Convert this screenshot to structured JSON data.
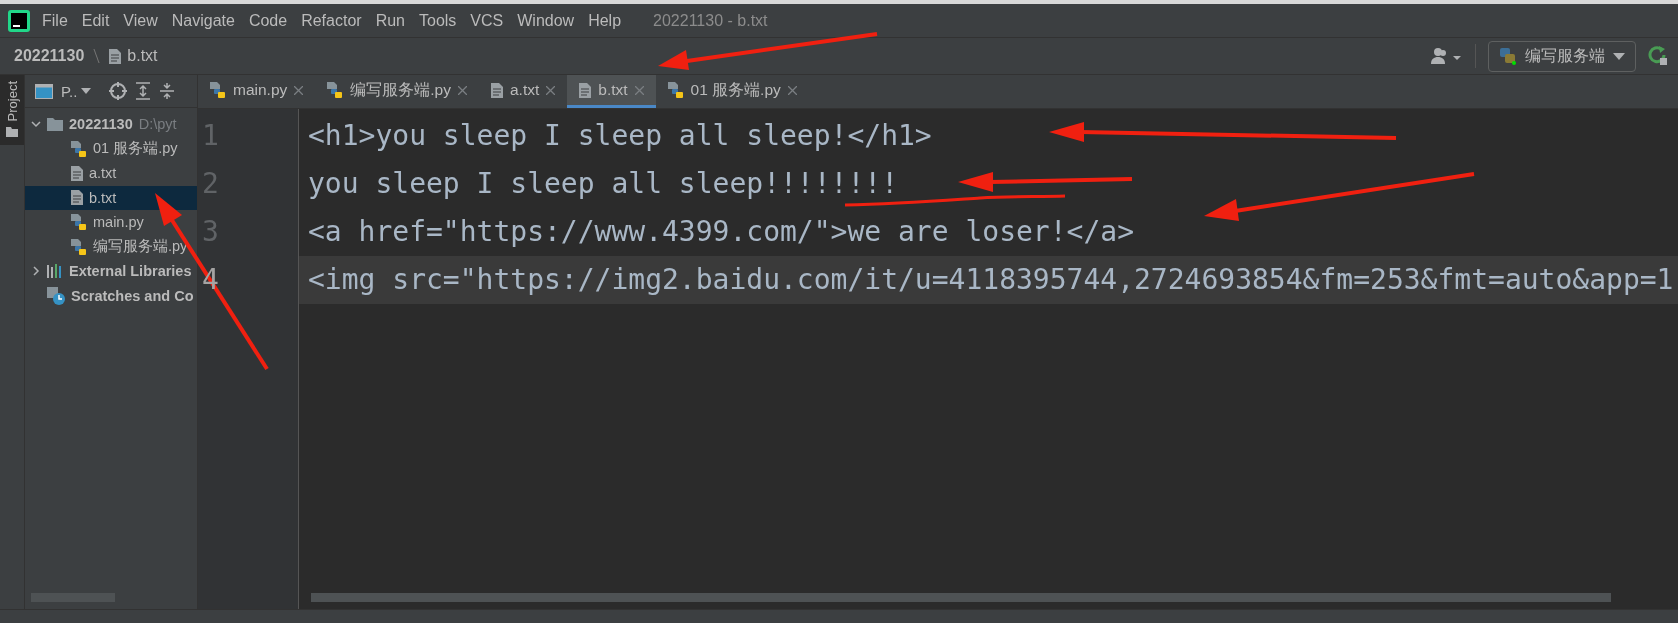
{
  "window": {
    "title": "20221130 - b.txt"
  },
  "menu": [
    "File",
    "Edit",
    "View",
    "Navigate",
    "Code",
    "Refactor",
    "Run",
    "Tools",
    "VCS",
    "Window",
    "Help"
  ],
  "breadcrumb": [
    {
      "label": "20221130",
      "kind": "folder"
    },
    {
      "label": "b.txt",
      "kind": "text"
    }
  ],
  "toolbar": {
    "run_config": "编写服务端"
  },
  "tool_stripe": [
    {
      "label": "Project",
      "selected": true
    }
  ],
  "project": {
    "title": "P..",
    "tree": [
      {
        "label": "20221130",
        "path": "D:\\pyt",
        "kind": "folder",
        "expanded": true,
        "selected": false,
        "children": [
          {
            "label": "01 服务端.py",
            "kind": "python",
            "selected": false
          },
          {
            "label": "a.txt",
            "kind": "text",
            "selected": false
          },
          {
            "label": "b.txt",
            "kind": "text",
            "selected": true
          },
          {
            "label": "main.py",
            "kind": "python",
            "selected": false
          },
          {
            "label": "编写服务端.py",
            "kind": "python",
            "selected": false
          }
        ]
      },
      {
        "label": "External Libraries",
        "kind": "library",
        "expanded": false,
        "selected": false
      },
      {
        "label": "Scratches and Co",
        "kind": "scratch",
        "selected": false
      }
    ]
  },
  "tabs": [
    {
      "label": "main.py",
      "kind": "python",
      "selected": false
    },
    {
      "label": "编写服务端.py",
      "kind": "python",
      "selected": false
    },
    {
      "label": "a.txt",
      "kind": "text",
      "selected": false
    },
    {
      "label": "b.txt",
      "kind": "text",
      "selected": true
    },
    {
      "label": "01 服务端.py",
      "kind": "python",
      "selected": false
    }
  ],
  "editor": {
    "lines": [
      {
        "number": "1",
        "text": "<h1>you sleep I sleep all sleep!</h1>",
        "current": false
      },
      {
        "number": "2",
        "text": "you sleep I sleep all sleep!!!!!!!!",
        "current": false
      },
      {
        "number": "3",
        "text": "<a href=\"https://www.4399.com/\">we are loser!</a>",
        "current": false
      },
      {
        "number": "4",
        "text": "<img src=\"https://img2.baidu.com/it/u=4118395744,2724693854&fm=253&fmt=auto&app=1",
        "current": true
      }
    ]
  }
}
